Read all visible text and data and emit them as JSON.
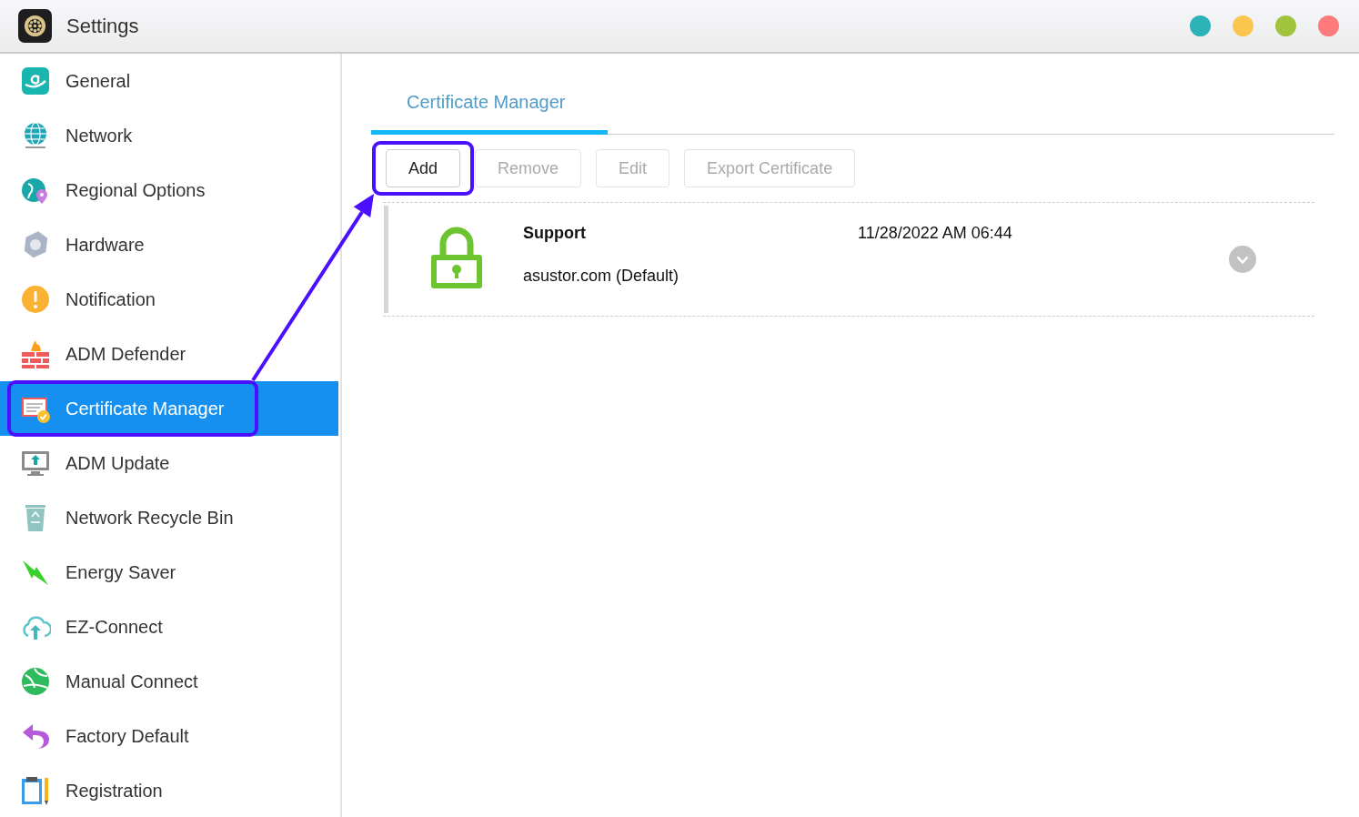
{
  "window": {
    "title": "Settings",
    "controls": [
      {
        "color": "#2bb3b8"
      },
      {
        "color": "#fbc64e"
      },
      {
        "color": "#a1c43e"
      },
      {
        "color": "#fd7b7b"
      }
    ]
  },
  "sidebar": {
    "items": [
      {
        "label": "General",
        "selected": false
      },
      {
        "label": "Network",
        "selected": false
      },
      {
        "label": "Regional Options",
        "selected": false
      },
      {
        "label": "Hardware",
        "selected": false
      },
      {
        "label": "Notification",
        "selected": false
      },
      {
        "label": "ADM Defender",
        "selected": false
      },
      {
        "label": "Certificate Manager",
        "selected": true
      },
      {
        "label": "ADM Update",
        "selected": false
      },
      {
        "label": "Network Recycle Bin",
        "selected": false
      },
      {
        "label": "Energy Saver",
        "selected": false
      },
      {
        "label": "EZ-Connect",
        "selected": false
      },
      {
        "label": "Manual Connect",
        "selected": false
      },
      {
        "label": "Factory Default",
        "selected": false
      },
      {
        "label": "Registration",
        "selected": false
      }
    ]
  },
  "tabs": [
    {
      "label": "Certificate Manager",
      "selected": true
    }
  ],
  "toolbar": [
    {
      "label": "Add",
      "disabled": false
    },
    {
      "label": "Remove",
      "disabled": true
    },
    {
      "label": "Edit",
      "disabled": true
    },
    {
      "label": "Export Certificate",
      "disabled": true
    }
  ],
  "certificates": [
    {
      "name": "Support",
      "domain": "asustor.com (Default)",
      "date": "11/28/2022 AM 06:44",
      "expanded": false
    }
  ]
}
